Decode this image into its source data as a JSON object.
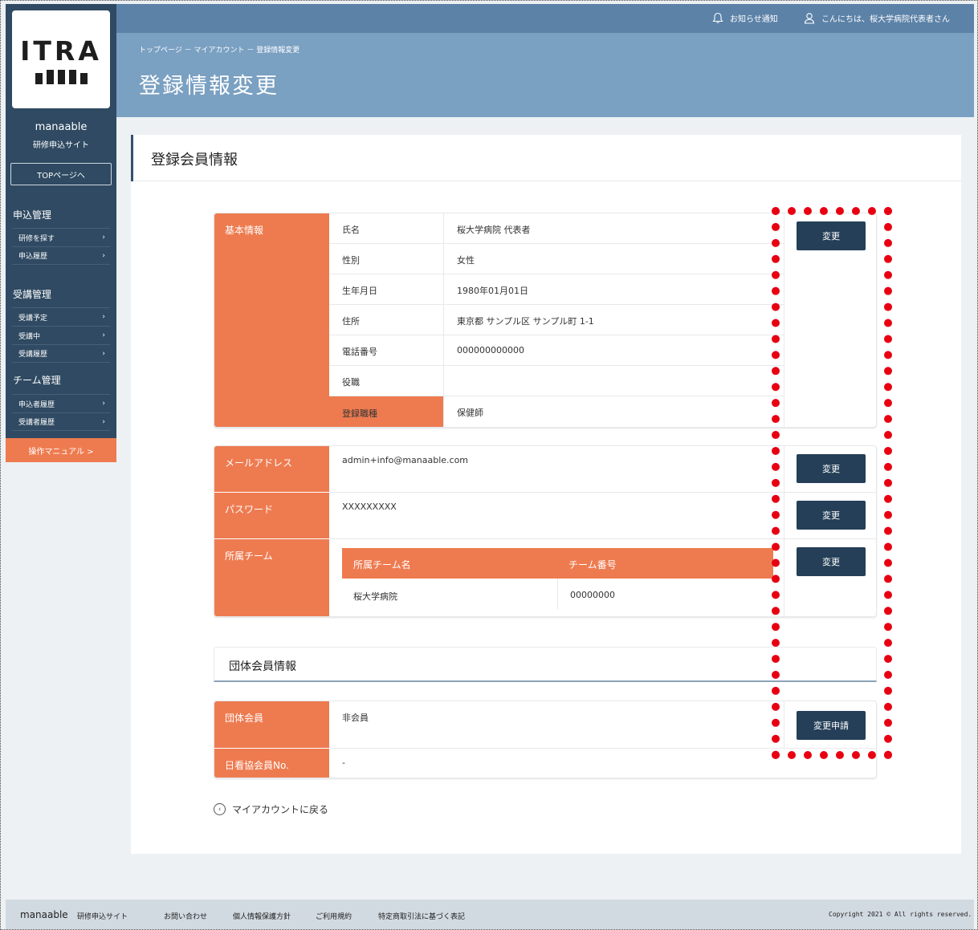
{
  "sidebar": {
    "logo_text": "ITRA",
    "site_name": "manaable",
    "site_sub": "研修申込サイト",
    "top_button": "TOPページへ",
    "sections": [
      {
        "title": "申込管理",
        "items": [
          "研修を探す",
          "申込履歴"
        ]
      },
      {
        "title": "受講管理",
        "items": [
          "受講予定",
          "受講中",
          "受講履歴"
        ]
      },
      {
        "title": "チーム管理",
        "items": [
          "申込者履歴",
          "受講者履歴"
        ]
      }
    ],
    "manual_button": "操作マニュアル >"
  },
  "header": {
    "notification": "お知らせ通知",
    "greeting": "こんにちは、桜大学病院代表者さん",
    "breadcrumb": "トップページ － マイアカウント － 登録情報変更",
    "page_title": "登録情報変更"
  },
  "main": {
    "card_title": "登録会員情報",
    "basic": {
      "label": "基本情報",
      "rows": [
        {
          "key": "氏名",
          "value": "桜大学病院 代表者"
        },
        {
          "key": "性別",
          "value": "女性"
        },
        {
          "key": "生年月日",
          "value": "1980年01月01日"
        },
        {
          "key": "住所",
          "value": "東京都 サンプル区 サンプル町 1-1"
        },
        {
          "key": "電話番号",
          "value": "000000000000"
        },
        {
          "key": "役職",
          "value": ""
        },
        {
          "key": "登録職種",
          "value": "保健師"
        }
      ],
      "button": "変更"
    },
    "email": {
      "label": "メールアドレス",
      "value": "admin+info@manaable.com",
      "button": "変更"
    },
    "password": {
      "label": "パスワード",
      "value": "XXXXXXXXX",
      "button": "変更"
    },
    "team": {
      "label": "所属チーム",
      "headers": [
        "所属チーム名",
        "チーム番号"
      ],
      "rows": [
        [
          "桜大学病院",
          "00000000"
        ]
      ],
      "button": "変更"
    },
    "group_title": "団体会員情報",
    "group": {
      "member_label": "団体会員",
      "member_value": "非会員",
      "nursing_label": "日看協会員No.",
      "nursing_value": "-",
      "button": "変更申請"
    },
    "back_link": "マイアカウントに戻る"
  },
  "footer": {
    "brand": "manaable",
    "brand_sub": "研修申込サイト",
    "links": [
      "お問い合わせ",
      "個人情報保護方針",
      "ご利用規約",
      "特定商取引法に基づく表記"
    ],
    "copyright": "Copyright 2021 © All rights reserved."
  },
  "colors": {
    "accent": "#ee7b50",
    "navy": "#243f57",
    "highlight": "#e60012"
  }
}
